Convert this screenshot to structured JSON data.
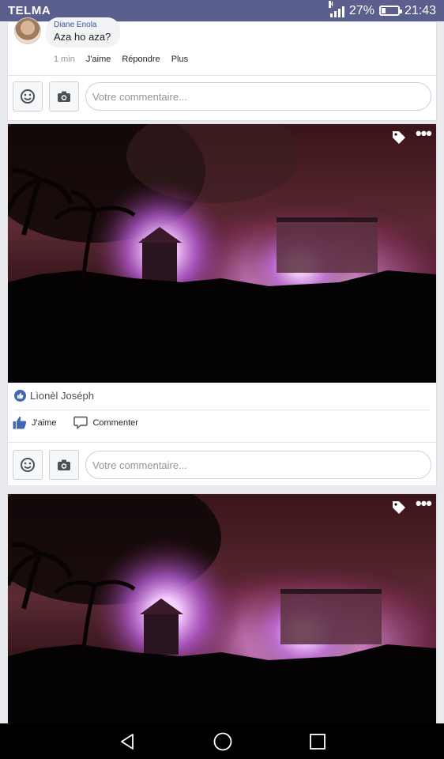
{
  "status_bar": {
    "carrier": "TELMA",
    "signal_type": "H",
    "battery": "27%",
    "time": "21:43",
    "battery_level": 0.27
  },
  "comment": {
    "author": "Diane Enola",
    "text": "Aza ho aza?",
    "time": "1 min",
    "like_label": "J'aime",
    "reply_label": "Répondre",
    "more_label": "Plus"
  },
  "compose": {
    "placeholder": "Votre commentaire..."
  },
  "post": {
    "liker": "Lìonèl Joséph",
    "like_label": "J'aime",
    "comment_label": "Commenter"
  },
  "colors": {
    "status_bar": "#5a5f8e",
    "link": "#365899",
    "like": "#4267b2",
    "background": "#e9ebee"
  },
  "icons": [
    "smiley-icon",
    "camera-icon",
    "tag-icon",
    "more-icon",
    "like-icon",
    "comment-icon",
    "back-icon",
    "home-icon",
    "recents-icon"
  ]
}
